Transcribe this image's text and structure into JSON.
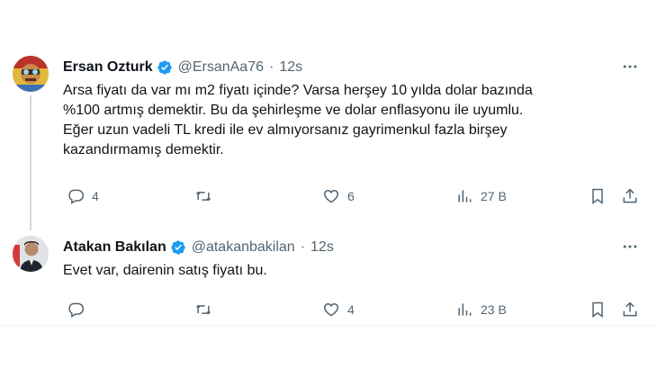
{
  "tweets": [
    {
      "name": "Ersan Ozturk",
      "handle": "@ErsanAa76",
      "separator": "·",
      "time": "12s",
      "lines": [
        "Arsa fiyatı da var mı m2 fiyatı içinde? Varsa herşey 10 yılda dolar bazında",
        "%100 artmış demektir. Bu da şehirleşme ve dolar enflasyonu ile uyumlu.",
        "Eğer uzun vadeli TL kredi ile ev almıyorsanız gayrimenkul fazla birşey",
        "kazandırmamış demektir."
      ],
      "replies": "4",
      "retweets": "",
      "likes": "6",
      "views": "27 B"
    },
    {
      "name": "Atakan Bakılan",
      "handle": "@atakanbakilan",
      "separator": "·",
      "time": "12s",
      "lines": [
        "Evet var, dairenin satış fiyatı bu."
      ],
      "replies": "",
      "retweets": "",
      "likes": "4",
      "views": "23 B"
    }
  ],
  "colors": {
    "verified": "#1d9bf0",
    "muted": "#536471",
    "text": "#0f1419"
  }
}
